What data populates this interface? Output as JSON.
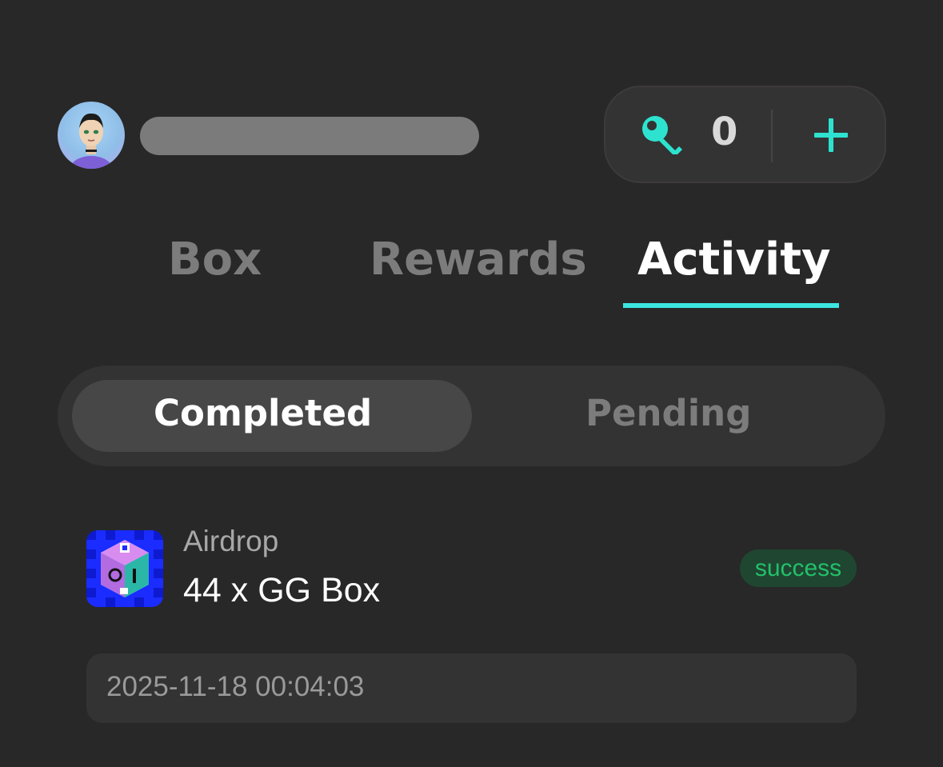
{
  "header": {
    "avatar_icon": "user-avatar",
    "username": "",
    "keys": {
      "icon": "key-icon",
      "count": "0",
      "add_icon": "plus-icon"
    }
  },
  "tabs": [
    {
      "label": "Box",
      "active": false
    },
    {
      "label": "Rewards",
      "active": false
    },
    {
      "label": "Activity",
      "active": true
    }
  ],
  "segment": {
    "options": [
      {
        "label": "Completed",
        "active": true
      },
      {
        "label": "Pending",
        "active": false
      }
    ]
  },
  "activity": {
    "items": [
      {
        "icon": "gg-box-thumbnail",
        "source": "Airdrop",
        "title": "44 x GG Box",
        "status": "success",
        "timestamp": "2025-11-18 00:04:03"
      }
    ]
  },
  "colors": {
    "background": "#282828",
    "accent": "#3ce6e1",
    "key": "#2de3cf",
    "success_text": "#23c06a",
    "success_bg": "#1f4631"
  }
}
